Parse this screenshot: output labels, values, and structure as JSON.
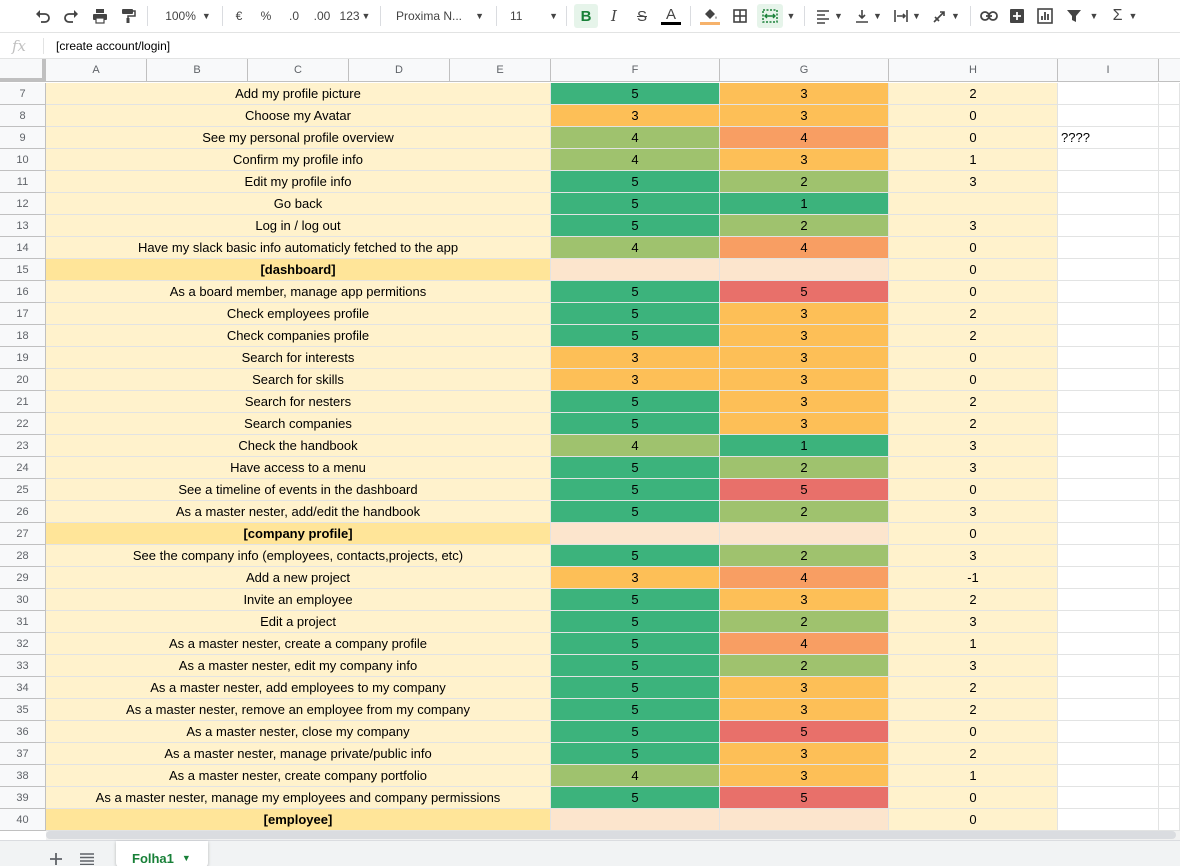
{
  "colors": {
    "yellow_bg": "#fff2cc",
    "header_bg": "#ffe599",
    "peach_bg": "#fce5cd",
    "score_5": "#3cb37c",
    "score_4": "#9fc26e",
    "score_3": "#fdbf57",
    "score_4_hot": "#f89e63",
    "score_5_hot": "#e8706a",
    "score_2": "#9fc26e",
    "score_1": "#3cb37c"
  },
  "toolbar": {
    "zoom": "100%",
    "currency": "€",
    "percent": "%",
    "dec_decrease": ".0",
    "dec_increase": ".00",
    "more_formats": "123",
    "font": "Proxima N...",
    "font_size": "11",
    "bold": "B",
    "italic": "I",
    "strike": "S",
    "text_color": "A"
  },
  "formula_bar": {
    "fx": "fx",
    "value": "[create account/login]"
  },
  "columns": [
    "A",
    "B",
    "C",
    "D",
    "E",
    "F",
    "G",
    "H",
    "I"
  ],
  "rows": [
    {
      "n": "7",
      "text": "Add my profile picture",
      "f": "5",
      "g": "3",
      "h": "2",
      "i": "",
      "header": false
    },
    {
      "n": "8",
      "text": "Choose my Avatar",
      "f": "3",
      "g": "3",
      "h": "0",
      "i": "",
      "header": false
    },
    {
      "n": "9",
      "text": "See my personal profile overview",
      "f": "4",
      "g": "4",
      "h": "0",
      "i": "????",
      "header": false
    },
    {
      "n": "10",
      "text": "Confirm my profile info",
      "f": "4",
      "g": "3",
      "h": "1",
      "i": "",
      "header": false
    },
    {
      "n": "11",
      "text": "Edit my profile info",
      "f": "5",
      "g": "2",
      "h": "3",
      "i": "",
      "header": false
    },
    {
      "n": "12",
      "text": "Go back",
      "f": "5",
      "g": "1",
      "h": "",
      "i": "",
      "header": false
    },
    {
      "n": "13",
      "text": "Log in / log out",
      "f": "5",
      "g": "2",
      "h": "3",
      "i": "",
      "header": false
    },
    {
      "n": "14",
      "text": "Have my slack basic info automaticly fetched to the app",
      "f": "4",
      "g": "4",
      "h": "0",
      "i": "",
      "header": false
    },
    {
      "n": "15",
      "text": "[dashboard]",
      "f": "",
      "g": "",
      "h": "0",
      "i": "",
      "header": true
    },
    {
      "n": "16",
      "text": "As a board member, manage app permitions",
      "f": "5",
      "g": "5",
      "h": "0",
      "i": "",
      "header": false
    },
    {
      "n": "17",
      "text": "Check employees profile",
      "f": "5",
      "g": "3",
      "h": "2",
      "i": "",
      "header": false
    },
    {
      "n": "18",
      "text": "Check companies profile",
      "f": "5",
      "g": "3",
      "h": "2",
      "i": "",
      "header": false
    },
    {
      "n": "19",
      "text": "Search for interests",
      "f": "3",
      "g": "3",
      "h": "0",
      "i": "",
      "header": false
    },
    {
      "n": "20",
      "text": "Search for skills",
      "f": "3",
      "g": "3",
      "h": "0",
      "i": "",
      "header": false
    },
    {
      "n": "21",
      "text": "Search for nesters",
      "f": "5",
      "g": "3",
      "h": "2",
      "i": "",
      "header": false
    },
    {
      "n": "22",
      "text": "Search companies",
      "f": "5",
      "g": "3",
      "h": "2",
      "i": "",
      "header": false
    },
    {
      "n": "23",
      "text": "Check the handbook",
      "f": "4",
      "g": "1",
      "h": "3",
      "i": "",
      "header": false
    },
    {
      "n": "24",
      "text": "Have access to a menu",
      "f": "5",
      "g": "2",
      "h": "3",
      "i": "",
      "header": false
    },
    {
      "n": "25",
      "text": "See a timeline of events in the dashboard",
      "f": "5",
      "g": "5",
      "h": "0",
      "i": "",
      "header": false
    },
    {
      "n": "26",
      "text": "As a master nester, add/edit the handbook",
      "f": "5",
      "g": "2",
      "h": "3",
      "i": "",
      "header": false
    },
    {
      "n": "27",
      "text": "[company profile]",
      "f": "",
      "g": "",
      "h": "0",
      "i": "",
      "header": true
    },
    {
      "n": "28",
      "text": "See the company info (employees, contacts,projects, etc)",
      "f": "5",
      "g": "2",
      "h": "3",
      "i": "",
      "header": false
    },
    {
      "n": "29",
      "text": "Add a new project",
      "f": "3",
      "g": "4",
      "h": "-1",
      "i": "",
      "header": false
    },
    {
      "n": "30",
      "text": "Invite an employee",
      "f": "5",
      "g": "3",
      "h": "2",
      "i": "",
      "header": false
    },
    {
      "n": "31",
      "text": "Edit a project",
      "f": "5",
      "g": "2",
      "h": "3",
      "i": "",
      "header": false
    },
    {
      "n": "32",
      "text": "As a master nester, create a company profile",
      "f": "5",
      "g": "4",
      "h": "1",
      "i": "",
      "header": false
    },
    {
      "n": "33",
      "text": "As a master nester, edit my company info",
      "f": "5",
      "g": "2",
      "h": "3",
      "i": "",
      "header": false
    },
    {
      "n": "34",
      "text": "As a master nester, add employees to my company",
      "f": "5",
      "g": "3",
      "h": "2",
      "i": "",
      "header": false
    },
    {
      "n": "35",
      "text": "As a master nester, remove an employee from my company",
      "f": "5",
      "g": "3",
      "h": "2",
      "i": "",
      "header": false
    },
    {
      "n": "36",
      "text": "As a master nester, close my company",
      "f": "5",
      "g": "5",
      "h": "0",
      "i": "",
      "header": false
    },
    {
      "n": "37",
      "text": "As a master nester, manage private/public info",
      "f": "5",
      "g": "3",
      "h": "2",
      "i": "",
      "header": false
    },
    {
      "n": "38",
      "text": "As a master nester, create company portfolio",
      "f": "4",
      "g": "3",
      "h": "1",
      "i": "",
      "header": false
    },
    {
      "n": "39",
      "text": "As a master nester, manage my employees and company permissions",
      "f": "5",
      "g": "5",
      "h": "0",
      "i": "",
      "header": false
    },
    {
      "n": "40",
      "text": "[employee]",
      "f": "",
      "g": "",
      "h": "0",
      "i": "",
      "header": true
    }
  ],
  "sheets": [
    {
      "name": "Folha1",
      "active": true
    }
  ]
}
